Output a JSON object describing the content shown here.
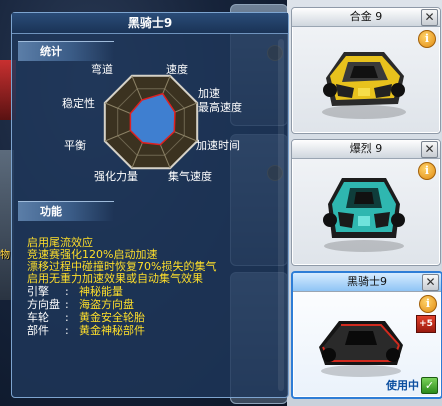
{
  "tooltip": {
    "title": "黑骑士9",
    "stats_header": "统计",
    "function_header": "功能",
    "radar_labels": {
      "turn": "弯道",
      "speed": "速度",
      "stability": "稳定性",
      "accel_top": "加速\n最高速度",
      "balance": "平衡",
      "accel_time": "加速时间",
      "enhance": "强化力量",
      "gauge_speed": "集气速度"
    },
    "radar_values": {
      "speed": 0.85,
      "accel_top": 0.72,
      "accel_time": 0.7,
      "gauge_speed": 0.68,
      "enhance": 0.62,
      "balance": 0.62,
      "stability": 0.62,
      "turn": 0.66
    },
    "function_lines": [
      "启用尾流效应",
      "竞速赛强化120%启动加速",
      "漂移过程中碰撞时恢复70%损失的集气",
      "启用无重力加速效果或自动集气效果"
    ],
    "parts": [
      {
        "key": "引擎",
        "colon": ":",
        "value": "神秘能量"
      },
      {
        "key": "方向盘",
        "colon": ":",
        "value": "海盗方向盘"
      },
      {
        "key": "车轮",
        "colon": ":",
        "value": "黄金安全轮胎"
      },
      {
        "key": "部件",
        "colon": ":",
        "value": "黄金神秘部件"
      }
    ]
  },
  "background": {
    "left_label": "物"
  },
  "cards": [
    {
      "title": "合金 9",
      "info": "i",
      "close": "✕"
    },
    {
      "title": "爆烈 9",
      "info": "i",
      "close": "✕"
    },
    {
      "title": "黑骑士9",
      "info": "i",
      "close": "✕",
      "badge": "+5",
      "status": "使用中",
      "check": "✓"
    }
  ],
  "colors": {
    "stat_fill": "#3f7fd0",
    "stat_outline": "#e02020",
    "function_text": "#ffdf2a",
    "selected_border": "#2e7dd6"
  },
  "icons": [
    "info-icon",
    "close-icon",
    "check-icon",
    "plus-level-badge"
  ]
}
